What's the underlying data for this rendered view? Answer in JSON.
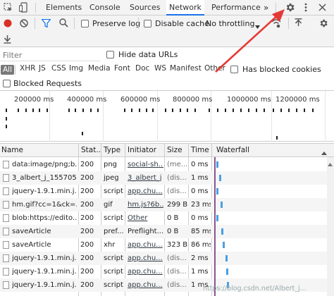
{
  "tabs": [
    "Elements",
    "Console",
    "Sources",
    "Network",
    "Performance"
  ],
  "tabs_more": "»",
  "toolbar": {
    "preserve_log": "Preserve log",
    "disable_cache": "Disable cache",
    "throttling": "No throttling"
  },
  "filter": {
    "placeholder": "Filter",
    "hide_data_urls": "Hide data URLs",
    "types": [
      "All",
      "XHR",
      "JS",
      "CSS",
      "Img",
      "Media",
      "Font",
      "Doc",
      "WS",
      "Manifest",
      "Other"
    ],
    "has_blocked_cookies": "Has blocked cookies",
    "blocked_requests": "Blocked Requests"
  },
  "overview": {
    "ticks": [
      "200000 ms",
      "400000 ms",
      "600000 ms",
      "800000 ms",
      "1000000 ms",
      "1200000 ms"
    ]
  },
  "columns": [
    "Name",
    "Stat...",
    "Type",
    "Initiator",
    "Size",
    "Time",
    "Waterfall"
  ],
  "rows": [
    {
      "name": "data:image/png;b...",
      "status": "200",
      "type": "png",
      "initiator": "social-sh...",
      "size": "(me...",
      "time": "0 ms"
    },
    {
      "name": "3_albert_j_155705...",
      "status": "200",
      "type": "jpeg",
      "initiator": "3_albert_j",
      "size": "(dis...",
      "time": "1 ms"
    },
    {
      "name": "jquery-1.9.1.min.j...",
      "status": "200",
      "type": "script",
      "initiator": "app.chu...",
      "size": "(dis...",
      "time": "0 ms"
    },
    {
      "name": "hm.gif?cc=1&ck=...",
      "status": "200",
      "type": "gif",
      "initiator": "hm.js?6b...",
      "size": "299 B",
      "time": "23 ms"
    },
    {
      "name": "blob:https://edito...",
      "status": "200",
      "type": "script",
      "initiator": "Other",
      "size": "0 B",
      "time": "0 ms"
    },
    {
      "name": "saveArticle",
      "status": "200",
      "type": "pref...",
      "initiator": "Preflight...",
      "size": "0 B",
      "time": "85 ms"
    },
    {
      "name": "saveArticle",
      "status": "200",
      "type": "xhr",
      "initiator": "app.chu...",
      "size": "323 B",
      "time": "86 ms"
    },
    {
      "name": "jquery-1.9.1.min.j...",
      "status": "200",
      "type": "script",
      "initiator": "app.chu...",
      "size": "(dis...",
      "time": "2 ms"
    },
    {
      "name": "jquery-1.9.1.min.j...",
      "status": "200",
      "type": "script",
      "initiator": "app.chu...",
      "size": "(dis...",
      "time": "1 ms"
    },
    {
      "name": "jquery-1.9.1.min.j...",
      "status": "200",
      "type": "script",
      "initiator": "app.chu...",
      "size": "(dis...",
      "time": "1 ms"
    }
  ],
  "watermark": "https://blog.csdn.net/Albert_j...",
  "colors": {
    "accent": "#1a73e8",
    "record": "#d93025",
    "arrow": "#e53935",
    "waterfall": "#4a9fe1"
  }
}
